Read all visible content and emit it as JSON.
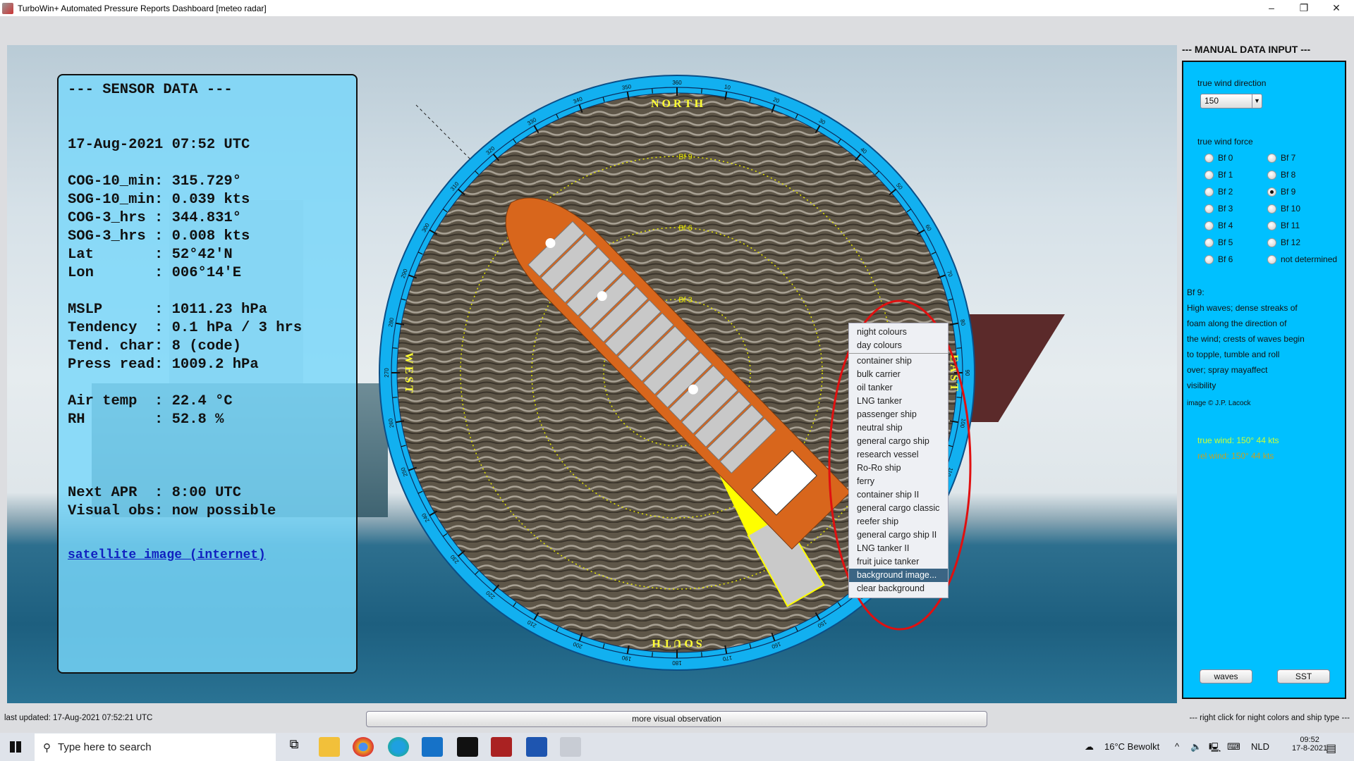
{
  "window": {
    "title": "TurboWin+ Automated Pressure Reports Dashboard [meteo radar]",
    "minimize": "–",
    "restore": "❐",
    "close": "✕"
  },
  "sensor": {
    "title": "--- SENSOR DATA ---",
    "datetime": "17-Aug-2021 07:52 UTC",
    "nav": [
      "COG-10_min: 315.729°",
      "SOG-10_min: 0.039 kts",
      "COG-3_hrs : 344.831°",
      "SOG-3_hrs : 0.008 kts",
      "Lat       : 52°42'N",
      "Lon       : 006°14'E"
    ],
    "pressure": [
      "MSLP      : 1011.23 hPa",
      "Tendency  : 0.1 hPa / 3 hrs",
      "Tend. char: 8 (code)",
      "Press read: 1009.2 hPa"
    ],
    "air": [
      "Air temp  : 22.4 °C",
      "RH        : 52.8 %"
    ],
    "next": [
      "Next APR  : 8:00 UTC",
      "Visual obs: now possible"
    ],
    "satellite_link": "satellite image (internet)"
  },
  "compass": {
    "cardinals": {
      "north": "N O R T H",
      "east": "E A S T",
      "south": "S O U T H",
      "west": "W E S T"
    },
    "rings": [
      "Bf 9",
      "Bf 6",
      "Bf 3"
    ],
    "ship_heading_deg": 315.729,
    "wind_from_deg": 150,
    "colors": {
      "ring": "#12b0f0",
      "ship": "#d8661c",
      "wind": "#ffff00",
      "bf_rings": "#e6e600"
    }
  },
  "context_menu": {
    "colour_items": [
      "night colours",
      "day colours"
    ],
    "ship_items": [
      "container ship",
      "bulk carrier",
      "oil tanker",
      "LNG tanker",
      "passenger ship",
      "neutral ship",
      "general cargo ship",
      "research vessel",
      "Ro-Ro ship",
      "ferry",
      "container ship II",
      "general cargo classic",
      "reefer ship",
      "general cargo ship II",
      "LNG tanker II",
      "fruit juice tanker"
    ],
    "bg_items": [
      "background image...",
      "clear background"
    ],
    "highlighted": "background image..."
  },
  "manual": {
    "title": "--- MANUAL DATA INPUT ---",
    "wind_dir_label": "true wind direction",
    "wind_dir_value": "150",
    "wind_force_label": "true wind force",
    "forces_col1": [
      "Bf 0",
      "Bf 1",
      "Bf 2",
      "Bf 3",
      "Bf 4",
      "Bf 5",
      "Bf 6"
    ],
    "forces_col2": [
      "Bf 7",
      "Bf 8",
      "Bf 9",
      "Bf 10",
      "Bf 11",
      "Bf 12",
      "not determined"
    ],
    "selected_force": "Bf 9",
    "desc_title": "Bf 9:",
    "desc_lines": [
      "High waves; dense streaks of",
      "foam along the direction of",
      "the wind; crests of waves begin",
      "to topple, tumble and roll",
      "over; spray mayaffect",
      "visibility"
    ],
    "credit": "image © J.P. Lacock",
    "true_wind": "true wind: 150° 44 kts",
    "rel_wind": "rel wind: 150° 44 kts",
    "true_wind_color": "#ccff33",
    "rel_wind_color": "#c8a020",
    "waves_btn": "waves",
    "sst_btn": "SST"
  },
  "status": {
    "last_updated": "last updated:  17-Aug-2021 07:52:21 UTC",
    "more_btn": "more visual observation",
    "hint": "--- right click for night colors and ship type ---"
  },
  "taskbar": {
    "search_placeholder": "Type here to search",
    "weather": "16°C  Bewolkt",
    "lang": "NLD",
    "time": "09:52",
    "date": "17-8-2021"
  }
}
